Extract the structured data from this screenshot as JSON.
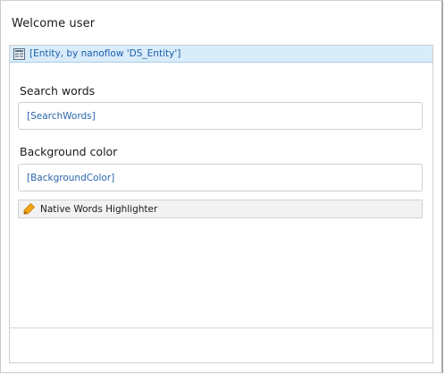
{
  "page": {
    "title": "Welcome user"
  },
  "dataview": {
    "icon": "dataview-icon",
    "label": "[Entity, by nanoflow 'DS_Entity']",
    "header_color": "#d9ecfa"
  },
  "fields": [
    {
      "label": "Search words",
      "value": "[SearchWords]"
    },
    {
      "label": "Background color",
      "value": "[BackgroundColor]"
    }
  ],
  "widget": {
    "icon": "highlighter-pen-icon",
    "label": "Native Words Highlighter",
    "icon_color": "#f2a516"
  },
  "colors": {
    "link_text": "#2a66aa",
    "border": "#cfcfcf"
  }
}
